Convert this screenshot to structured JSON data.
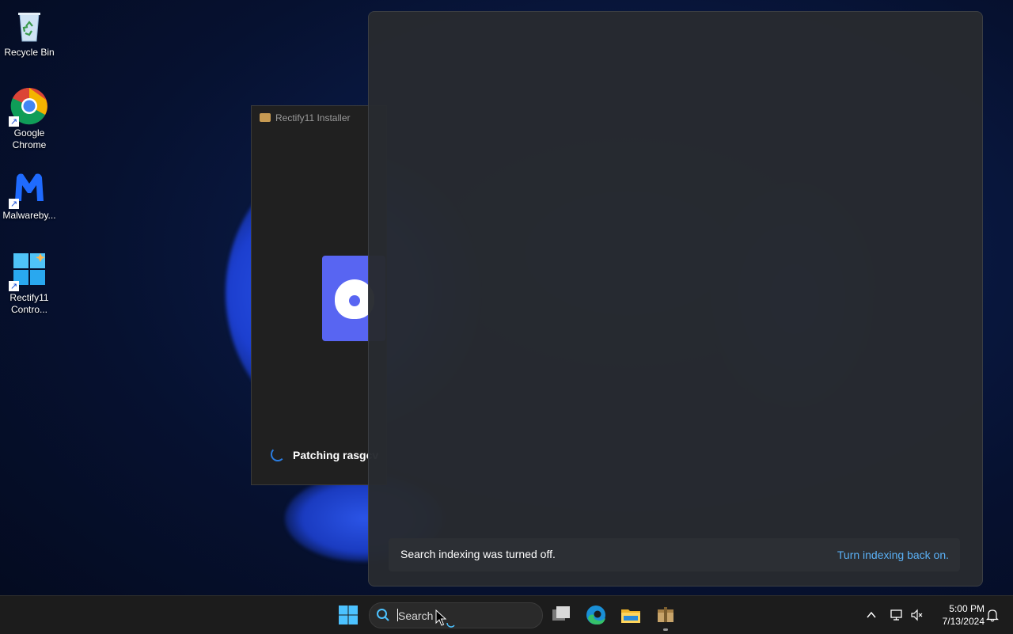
{
  "desktop": {
    "icons": [
      {
        "label": "Recycle Bin"
      },
      {
        "label": "Google Chrome"
      },
      {
        "label": "Malwareby..."
      },
      {
        "label": "Rectify11 Contro..."
      }
    ]
  },
  "installer": {
    "title": "Rectify11 Installer",
    "status": "Patching rasgcv"
  },
  "flyout": {
    "notice_message": "Search indexing was turned off.",
    "notice_link": "Turn indexing back on."
  },
  "taskbar": {
    "search_placeholder": "Search",
    "time": "5:00 PM",
    "date": "7/13/2024"
  },
  "colors": {
    "accent": "#5ab0f5",
    "discord": "#5865f2",
    "taskbar": "#1c1c1c"
  }
}
